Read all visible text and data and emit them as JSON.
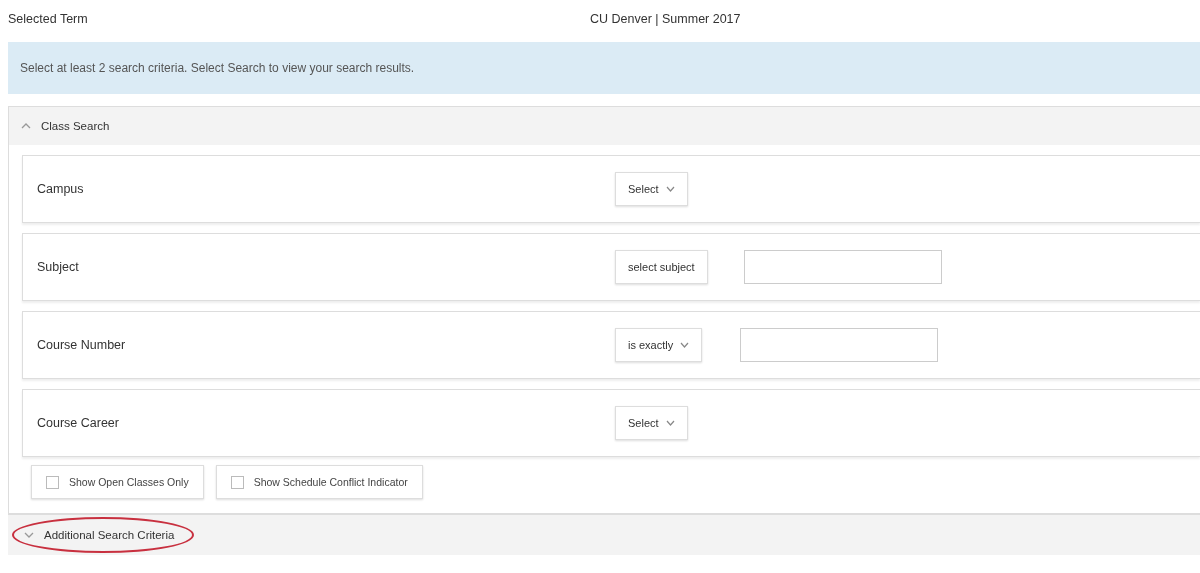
{
  "selected_term": {
    "label": "Selected Term",
    "value": "CU Denver | Summer 2017"
  },
  "info_banner": "Select at least 2 search criteria. Select Search to view your search results.",
  "class_search": {
    "title": "Class Search",
    "expanded": true,
    "criteria": [
      {
        "label": "Campus",
        "kind": "dropdown",
        "control": "Select"
      },
      {
        "label": "Subject",
        "kind": "button-input",
        "control": "select subject"
      },
      {
        "label": "Course Number",
        "kind": "dropdown-input",
        "control": "is exactly"
      },
      {
        "label": "Course Career",
        "kind": "dropdown",
        "control": "Select"
      }
    ],
    "checkboxes": [
      {
        "label": "Show Open Classes Only",
        "checked": false
      },
      {
        "label": "Show Schedule Conflict Indicator",
        "checked": false
      }
    ]
  },
  "additional_section": {
    "title": "Additional Search Criteria",
    "expanded": false,
    "circled": true
  }
}
